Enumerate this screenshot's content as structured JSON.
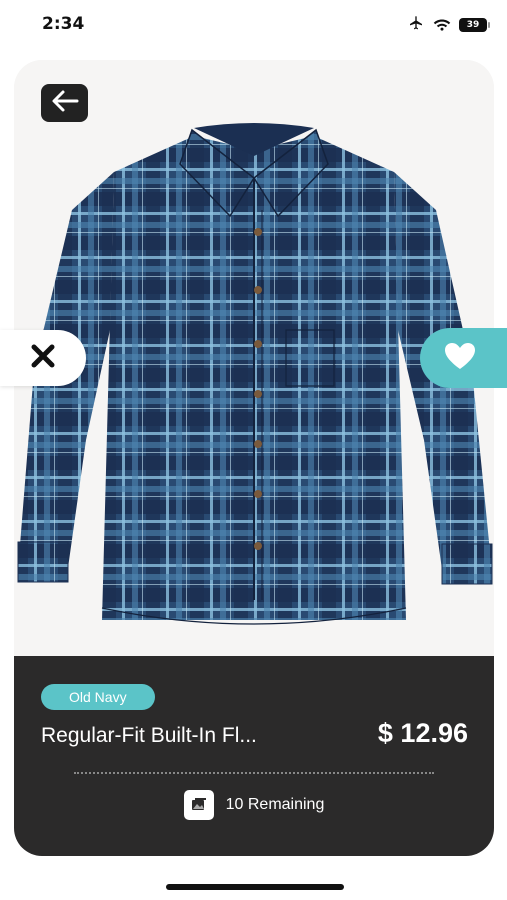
{
  "status_bar": {
    "time": "2:34",
    "battery_level": "39",
    "icons": [
      "airplane-icon",
      "wifi-icon",
      "battery-icon"
    ]
  },
  "product": {
    "brand": "Old Navy",
    "title": "Regular-Fit Built-In Fl...",
    "price": "$ 12.96",
    "image_subject": "blue plaid long-sleeve button-up shirt"
  },
  "actions": {
    "back_icon": "arrow-left-icon",
    "dislike_icon": "x-icon",
    "like_icon": "heart-icon"
  },
  "footer": {
    "remaining_text": "10 Remaining",
    "remaining_icon": "image-stack-icon"
  },
  "colors": {
    "accent": "#5bc4c8",
    "panel": "#2b2a2a",
    "shirt_dark": "#1f3558",
    "shirt_mid": "#3a6a92",
    "shirt_light": "#7fb4d6"
  }
}
